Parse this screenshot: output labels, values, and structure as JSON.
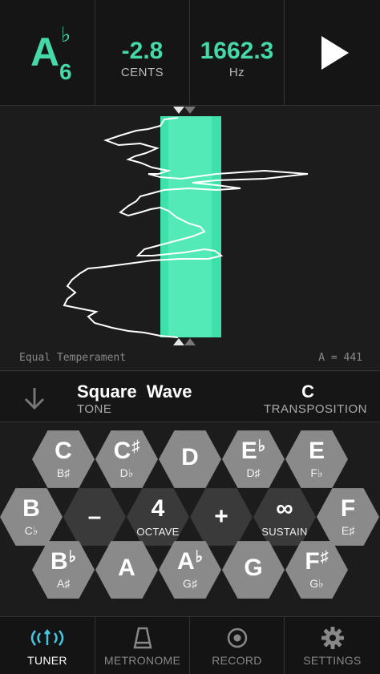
{
  "readout": {
    "note_letter": "A",
    "note_accidental": "♭",
    "note_octave": "6",
    "cents_value": "-2.8",
    "cents_label": "CENTS",
    "hz_value": "1662.3",
    "hz_label": "Hz"
  },
  "waveform": {
    "temperament": "Equal Temperament",
    "a_reference": "A = 441"
  },
  "tone": {
    "value": "Square  Wave",
    "label": "TONE",
    "transposition_value": "C",
    "transposition_label": "TRANSPOSITION"
  },
  "keypad": {
    "row1": [
      {
        "main": "C",
        "acc": "",
        "sub": "B♯"
      },
      {
        "main": "C",
        "acc": "♯",
        "sub": "D♭"
      },
      {
        "main": "D",
        "acc": "",
        "sub": ""
      },
      {
        "main": "E",
        "acc": "♭",
        "sub": "D♯"
      },
      {
        "main": "E",
        "acc": "",
        "sub": "F♭"
      }
    ],
    "row2_left": {
      "main": "B",
      "acc": "",
      "sub": "C♭"
    },
    "row2_right": {
      "main": "F",
      "acc": "",
      "sub": "E♯"
    },
    "minus": "–",
    "octave_value": "4",
    "octave_label": "OCTAVE",
    "plus": "+",
    "sustain_symbol": "∞",
    "sustain_label": "SUSTAIN",
    "row3": [
      {
        "main": "B",
        "acc": "♭",
        "sub": "A♯"
      },
      {
        "main": "A",
        "acc": "",
        "sub": ""
      },
      {
        "main": "A",
        "acc": "♭",
        "sub": "G♯"
      },
      {
        "main": "G",
        "acc": "",
        "sub": ""
      },
      {
        "main": "F",
        "acc": "♯",
        "sub": "G♭"
      }
    ]
  },
  "nav": {
    "tuner": "TUNER",
    "metronome": "METRONOME",
    "record": "RECORD",
    "settings": "SETTINGS"
  },
  "colors": {
    "accent": "#45d9a8",
    "background": "#1a1a1a",
    "key_light": "#8a8a8a",
    "key_dark": "#3a3a3a"
  },
  "icons": [
    "tuner-icon",
    "metronome-icon",
    "record-icon",
    "settings-icon",
    "play-icon",
    "arrow-down-icon"
  ]
}
